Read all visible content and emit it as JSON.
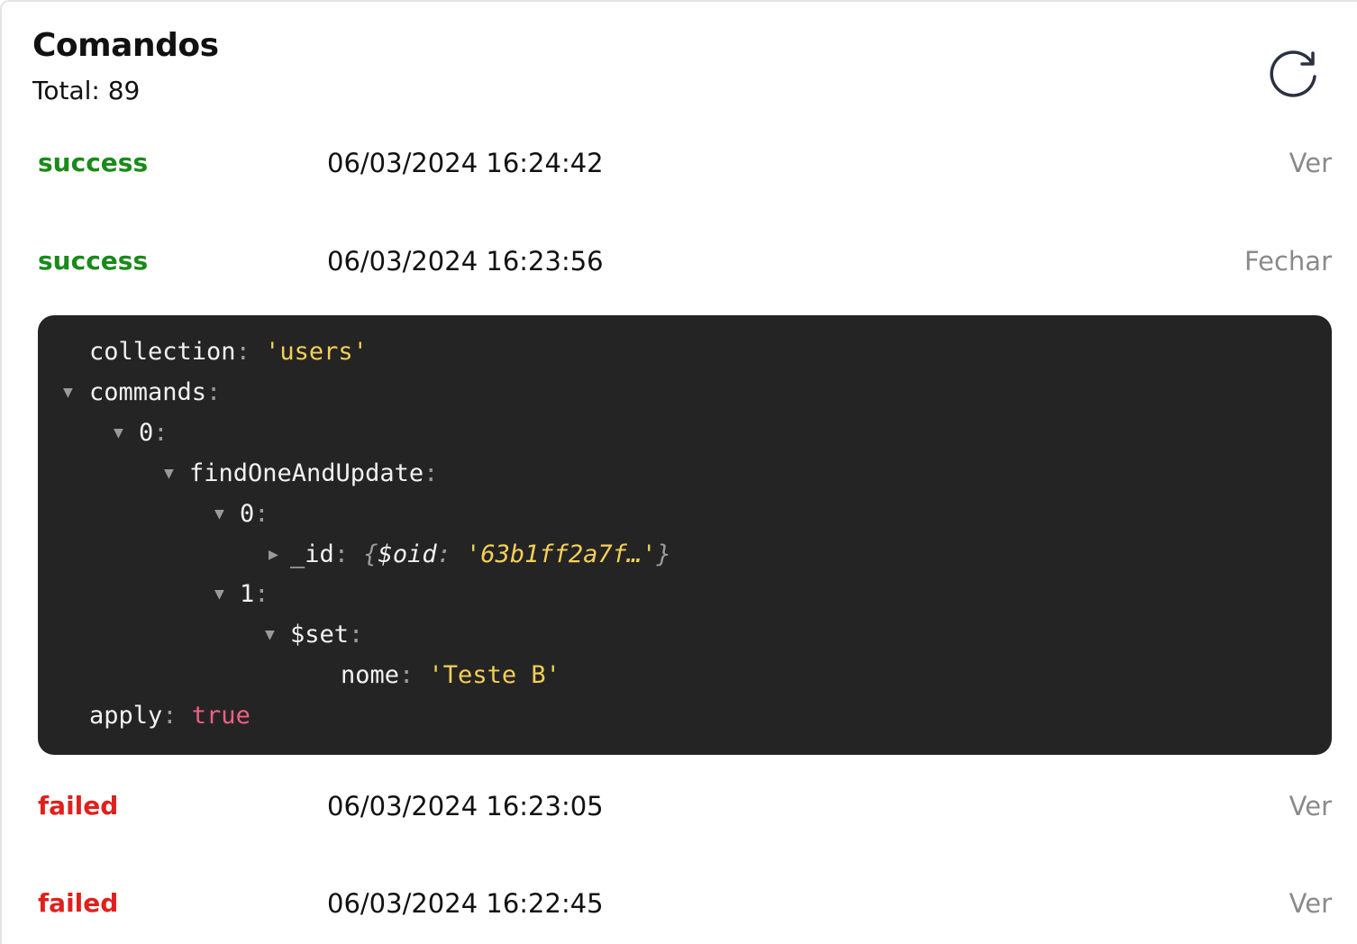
{
  "header": {
    "title": "Comandos",
    "total": "Total: 89"
  },
  "icons": {
    "refresh": "refresh-icon",
    "expanded": "▼",
    "collapsed": "▶"
  },
  "colors": {
    "success": "#1a8a1a",
    "failed": "#e0201c",
    "action": "#8a8a8a",
    "code_bg": "#242424",
    "code_string": "#f5cf57",
    "code_bool": "#ef5f85"
  },
  "rows": [
    {
      "status": "success",
      "time": "06/03/2024 16:24:42",
      "action": "Ver"
    },
    {
      "status": "success",
      "time": "06/03/2024 16:23:56",
      "action": "Fechar"
    },
    {
      "status": "failed",
      "time": "06/03/2024 16:23:05",
      "action": "Ver"
    },
    {
      "status": "failed",
      "time": "06/03/2024 16:22:45",
      "action": "Ver"
    }
  ],
  "code": {
    "collection_key": "collection",
    "collection_value": "'users'",
    "commands_key": "commands",
    "index0_key": "0",
    "find_key": "findOneAndUpdate",
    "find_index0_key": "0",
    "id_key": "_id",
    "id_preview_open": "{",
    "id_preview_key": "$oid",
    "id_preview_value": "'63b1ff2a7f…'",
    "id_preview_close": "}",
    "find_index1_key": "1",
    "set_key": "$set",
    "nome_key": "nome",
    "nome_value": "'Teste B'",
    "apply_key": "apply",
    "apply_value": "true"
  }
}
